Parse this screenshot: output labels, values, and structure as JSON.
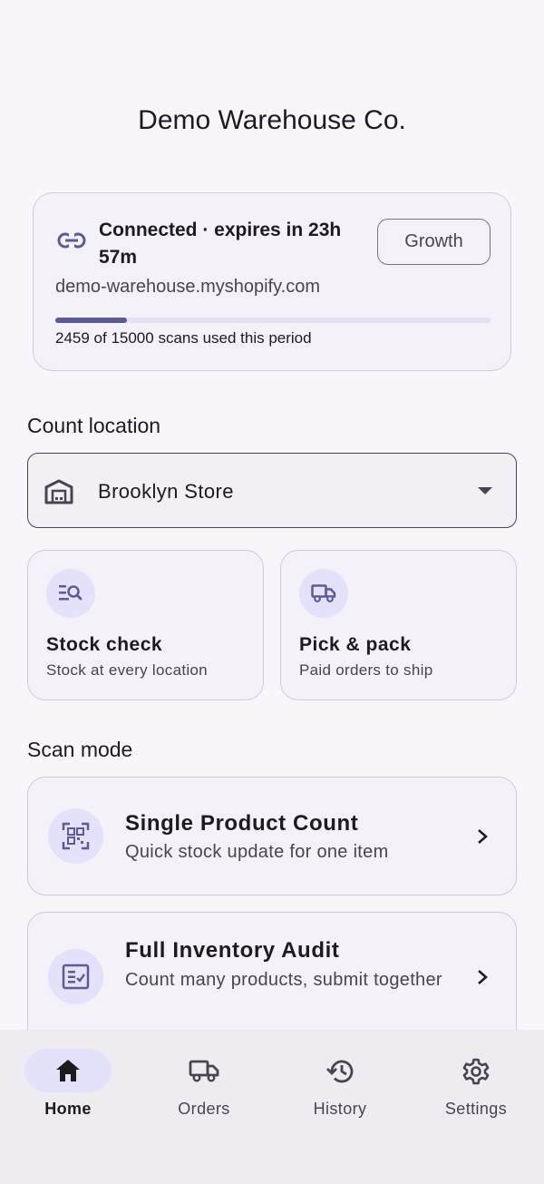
{
  "app": {
    "title": "Demo Warehouse Co."
  },
  "connection": {
    "status": "Connected · expires in 23h 57m",
    "plan_button": "Growth",
    "domain": "demo-warehouse.myshopify.com",
    "usage_text": "2459 of 15000 scans used this period",
    "scans_used": 2459,
    "scans_limit": 15000,
    "usage_fraction": 0.164
  },
  "location": {
    "label": "Count location",
    "selected": "Brooklyn Store"
  },
  "actions": [
    {
      "title": "Stock check",
      "subtitle": "Stock at every location",
      "icon": "search-list-icon"
    },
    {
      "title": "Pick & pack",
      "subtitle": "Paid orders to ship",
      "icon": "truck-icon"
    }
  ],
  "scan_mode": {
    "label": "Scan mode",
    "items": [
      {
        "title": "Single Product Count",
        "subtitle": "Quick stock update for one item",
        "icon": "qr-code-icon"
      },
      {
        "title": "Full Inventory Audit",
        "subtitle": "Count many products, submit together",
        "icon": "checklist-icon"
      }
    ]
  },
  "nav": {
    "items": [
      {
        "label": "Home",
        "icon": "home-icon",
        "active": true
      },
      {
        "label": "Orders",
        "icon": "truck-icon",
        "active": false
      },
      {
        "label": "History",
        "icon": "history-icon",
        "active": false
      },
      {
        "label": "Settings",
        "icon": "gear-icon",
        "active": false
      }
    ]
  },
  "colors": {
    "background": "#f8f6fb",
    "accent": "#5d5b96",
    "icon_bubble": "#e4e2fa",
    "card": "#f4f1f8",
    "nav_bar": "#efecf1"
  }
}
